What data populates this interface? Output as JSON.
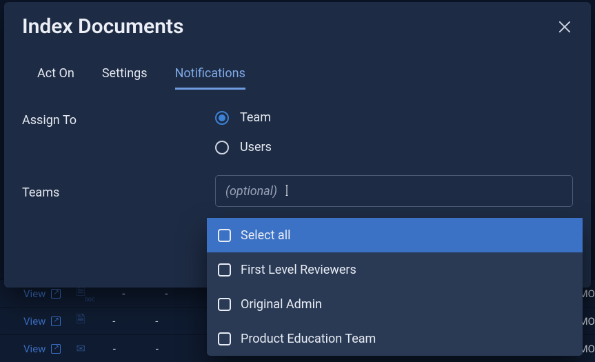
{
  "modal": {
    "title": "Index Documents",
    "tabs": [
      {
        "label": "Act On",
        "active": false
      },
      {
        "label": "Settings",
        "active": false
      },
      {
        "label": "Notifications",
        "active": true
      }
    ],
    "assign_to": {
      "label": "Assign To",
      "options": [
        {
          "label": "Team",
          "selected": true
        },
        {
          "label": "Users",
          "selected": false
        }
      ]
    },
    "teams": {
      "label": "Teams",
      "placeholder": "(optional)",
      "dropdown": [
        {
          "label": "Select all",
          "highlighted": true
        },
        {
          "label": "First Level Reviewers",
          "highlighted": false
        },
        {
          "label": "Original Admin",
          "highlighted": false
        },
        {
          "label": "Product Education Team",
          "highlighted": false
        }
      ]
    }
  },
  "bg": {
    "view": "View",
    "dash": "-",
    "mo": "MO"
  }
}
